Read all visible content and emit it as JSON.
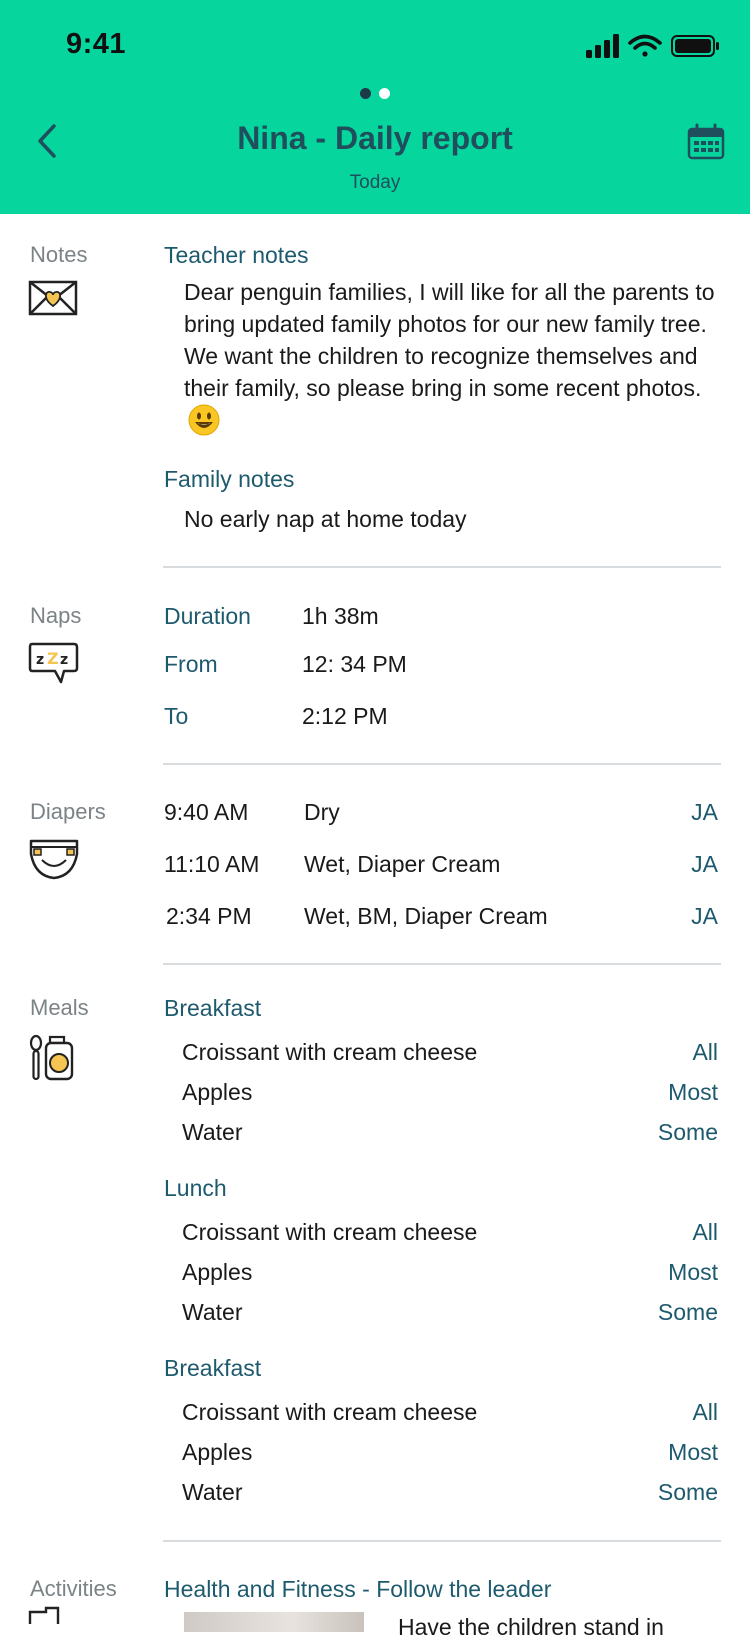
{
  "status_bar": {
    "time": "9:41"
  },
  "header": {
    "title": "Nina - Daily report",
    "subtitle": "Today",
    "page_count": 2,
    "active_page": 1
  },
  "icons": {
    "back": "chevron-left-icon",
    "calendar": "calendar-icon",
    "notes": "envelope-heart-icon",
    "naps": "sleep-bubble-icon",
    "diapers": "diaper-icon",
    "meals": "meal-icon",
    "activities": "activity-icon"
  },
  "colors": {
    "header_bg": "#06d69e",
    "accent": "#1e5a6e",
    "label_gray": "#7c8387",
    "icon_yellow": "#f5c451"
  },
  "notes": {
    "label": "Notes",
    "teacher_heading": "Teacher notes",
    "teacher_text": "Dear penguin families, I will like for all the parents to bring updated family photos for our new family tree. We want the children to recognize themselves and their family, so please bring in some recent photos.",
    "family_heading": "Family notes",
    "family_text": "No early nap at home today"
  },
  "naps": {
    "label": "Naps",
    "rows": [
      {
        "key": "Duration",
        "value": "1h 38m"
      },
      {
        "key": "From",
        "value": "12: 34 PM"
      },
      {
        "key": "To",
        "value": "2:12 PM"
      }
    ]
  },
  "diapers": {
    "label": "Diapers",
    "rows": [
      {
        "time": "9:40 AM",
        "desc": "Dry",
        "by": "JA"
      },
      {
        "time": "11:10 AM",
        "desc": "Wet, Diaper Cream",
        "by": "JA"
      },
      {
        "time": "2:34 PM",
        "desc": "Wet, BM, Diaper Cream",
        "by": "JA"
      }
    ]
  },
  "meals": {
    "label": "Meals",
    "groups": [
      {
        "name": "Breakfast",
        "items": [
          {
            "food": "Croissant with cream cheese",
            "amount": "All"
          },
          {
            "food": "Apples",
            "amount": "Most"
          },
          {
            "food": "Water",
            "amount": "Some"
          }
        ]
      },
      {
        "name": "Lunch",
        "items": [
          {
            "food": "Croissant with cream cheese",
            "amount": "All"
          },
          {
            "food": "Apples",
            "amount": "Most"
          },
          {
            "food": "Water",
            "amount": "Some"
          }
        ]
      },
      {
        "name": "Breakfast",
        "items": [
          {
            "food": "Croissant with cream cheese",
            "amount": "All"
          },
          {
            "food": "Apples",
            "amount": "Most"
          },
          {
            "food": "Water",
            "amount": "Some"
          }
        ]
      }
    ]
  },
  "activities": {
    "label": "Activities",
    "title": "Health and Fitness - Follow the leader",
    "text": "Have the children stand in"
  }
}
